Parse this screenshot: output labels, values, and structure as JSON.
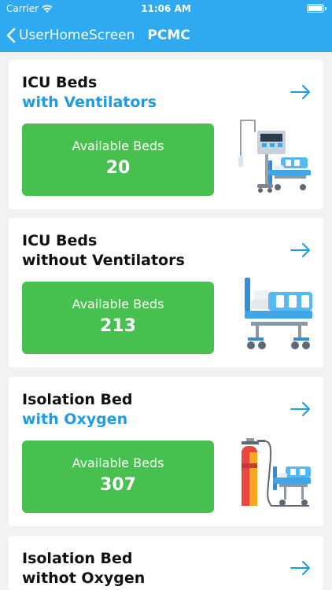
{
  "status_bar": {
    "carrier": "Carrier",
    "time": "11:06 AM"
  },
  "nav": {
    "back_label": "UserHomeScreen",
    "title": "PCMC"
  },
  "cards": [
    {
      "line1": "ICU Beds",
      "line2": "with Ventilators",
      "available_label": "Available Beds",
      "count": "20",
      "illustration": "icu-ventilator-bed"
    },
    {
      "line1": "ICU Beds",
      "line2": "without Ventilators",
      "available_label": "Available Beds",
      "count": "213",
      "illustration": "icu-bed"
    },
    {
      "line1": "Isolation Bed",
      "line2": "with Oxygen",
      "available_label": "Available Beds",
      "count": "307",
      "illustration": "oxygen-cylinder-bed"
    },
    {
      "line1": "Isolation Bed",
      "line2": "withot Oxygen",
      "illustration": "isolation-bed"
    }
  ],
  "colors": {
    "header": "#2fa9ef",
    "accent_text": "#1f9de3",
    "available_bg": "#48c04f"
  }
}
